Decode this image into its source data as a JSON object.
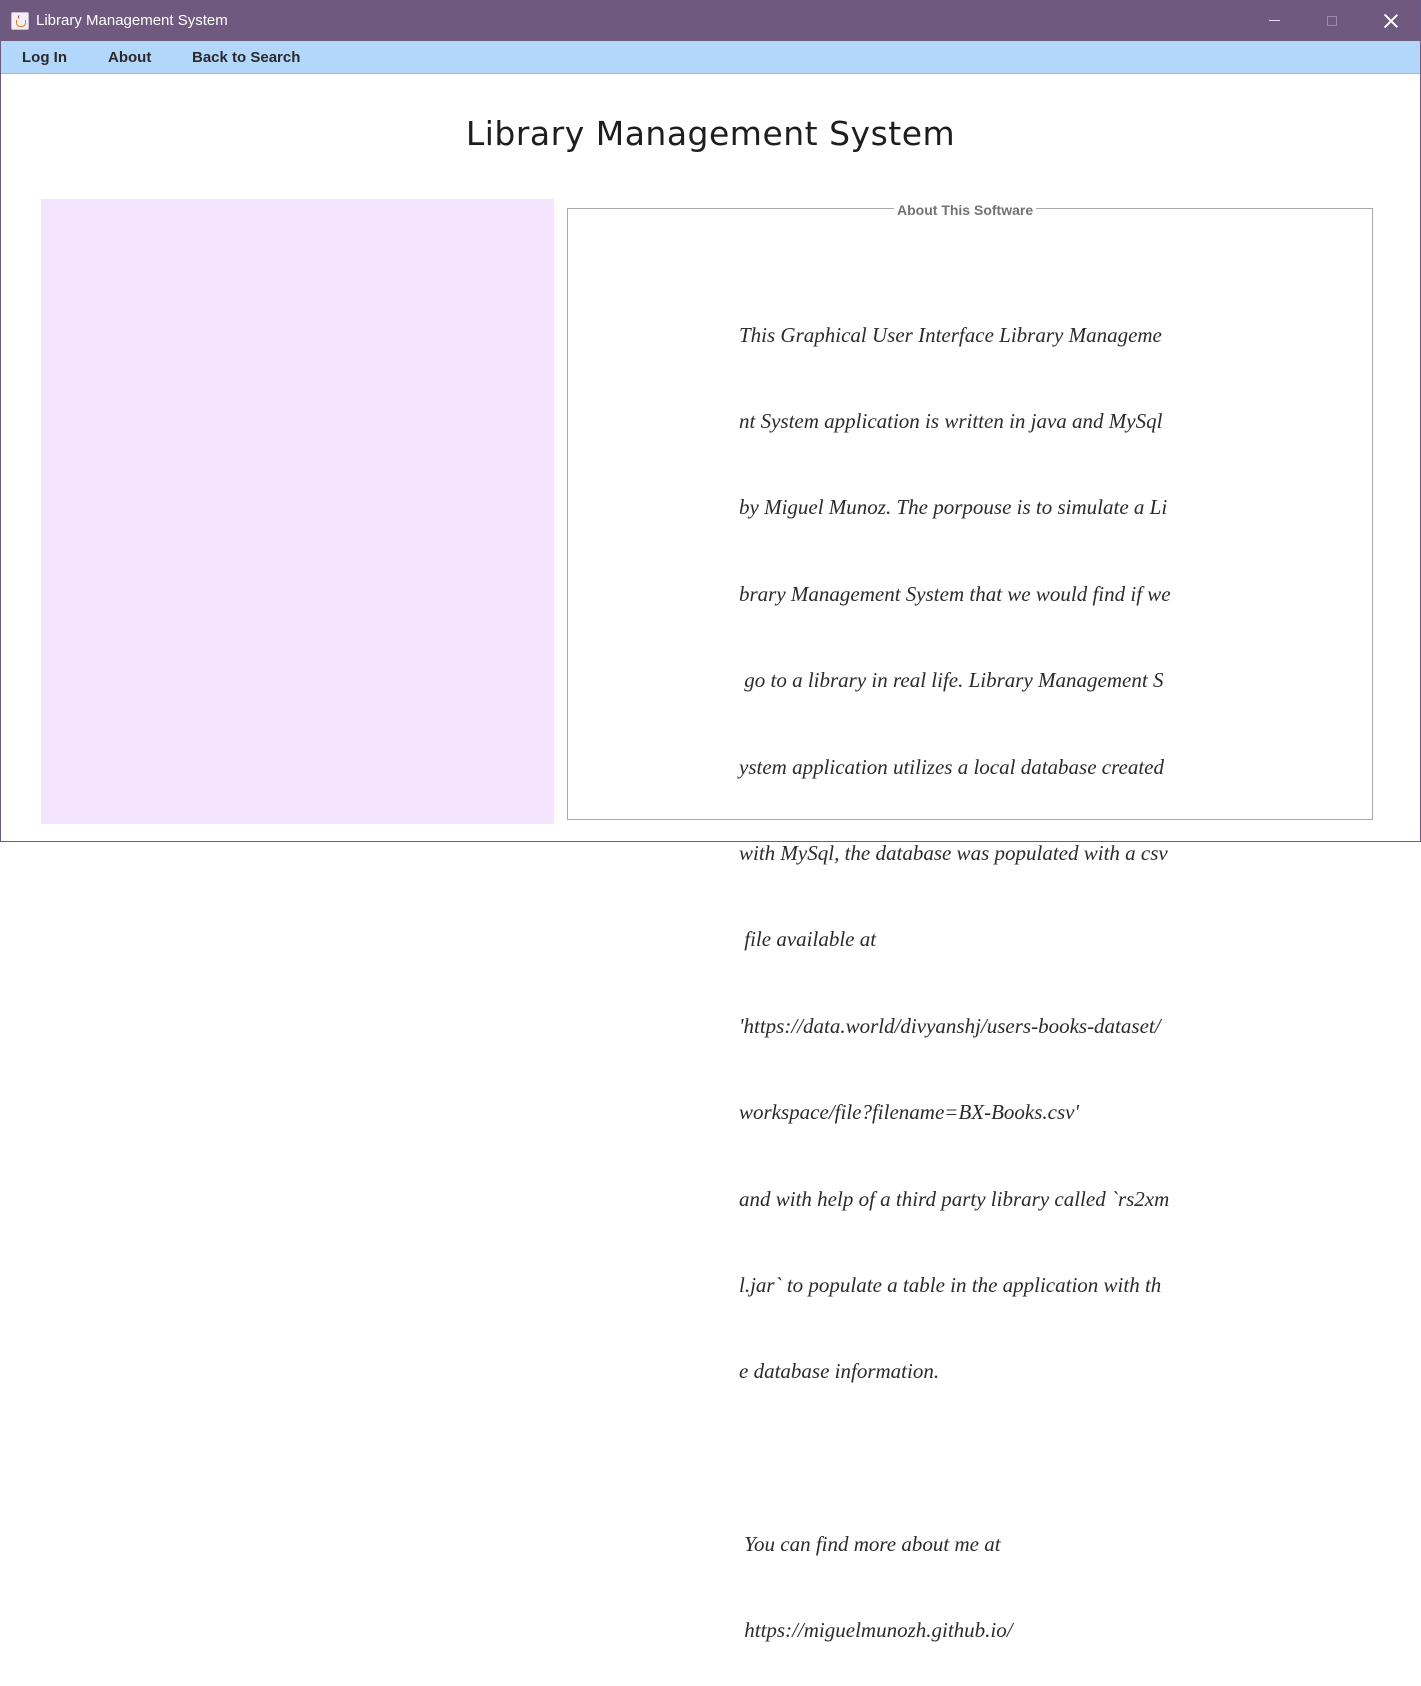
{
  "window": {
    "title": "Library Management System"
  },
  "menu": {
    "items": [
      {
        "label": "Log In"
      },
      {
        "label": "About"
      },
      {
        "label": "Back to Search"
      }
    ]
  },
  "main": {
    "heading": "Library Management System",
    "about": {
      "legend": "About This Software",
      "lines": [
        "This Graphical User Interface Library Manageme",
        "nt System application is written in java and MySql",
        "by Miguel Munoz. The porpouse is to simulate a Li",
        "brary Management System that we would find if we",
        " go to a library in real life. Library Management S",
        "ystem application utilizes a local database created",
        "with MySql, the database was populated with a csv",
        " file available at",
        "'https://data.world/divyanshj/users-books-dataset/",
        "workspace/file?filename=BX-Books.csv'",
        "and with help of a third party library called `rs2xm",
        "l.jar` to populate a table in the application with th",
        "e database information.",
        "",
        " You can find more about me at",
        " https://miguelmunozh.github.io/"
      ]
    }
  },
  "colors": {
    "titlebar": "#6f597f",
    "menubar": "#b3d7fb",
    "left_panel": "#f4e4fd"
  },
  "icons": {
    "app": "java-cup-icon",
    "minimize": "minimize-icon",
    "maximize": "maximize-icon",
    "close": "close-icon"
  }
}
